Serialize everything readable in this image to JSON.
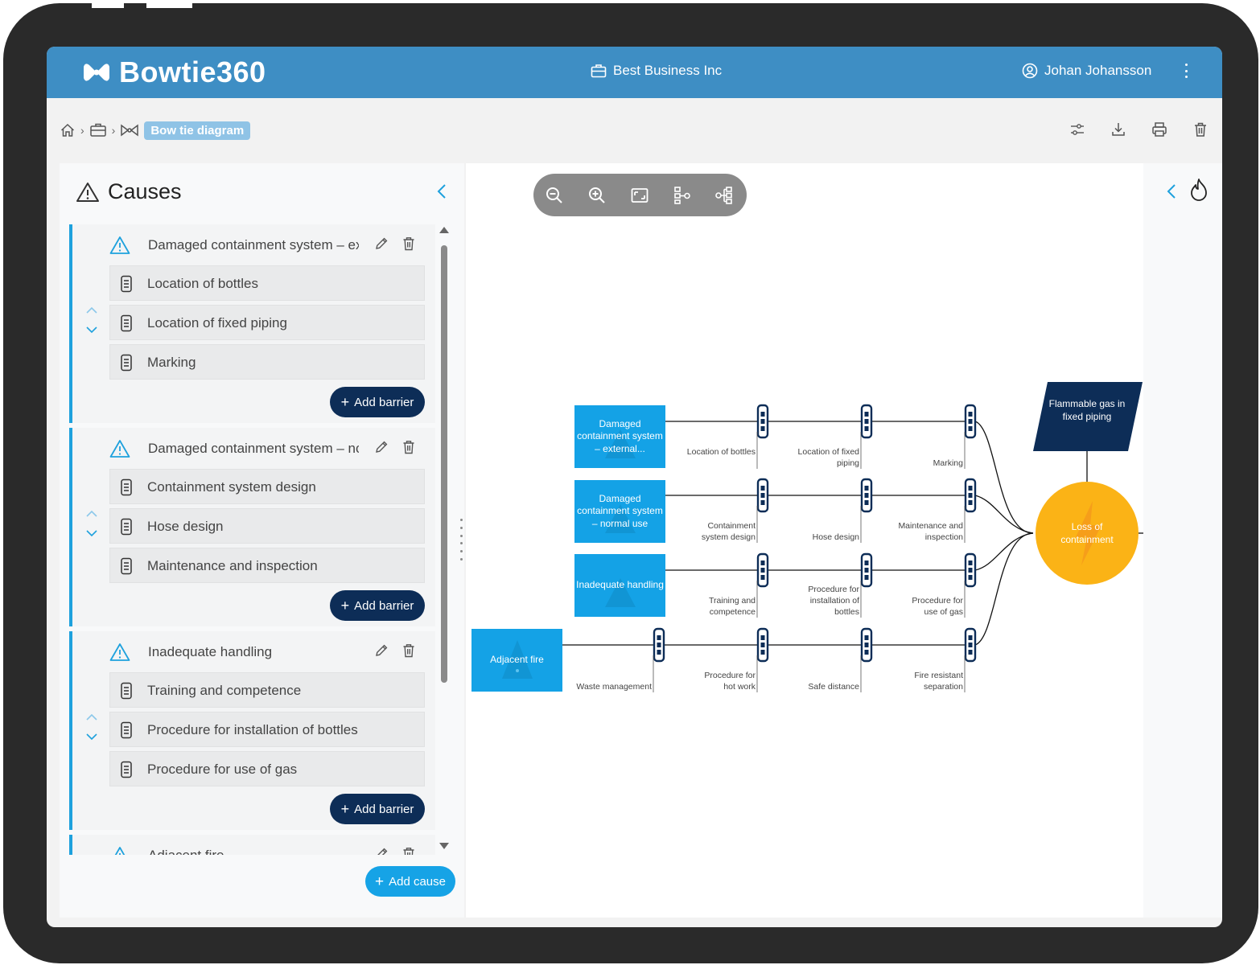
{
  "app": {
    "name": "Bowtie360",
    "company": "Best Business Inc",
    "user": "Johan Johansson"
  },
  "breadcrumb": {
    "current": "Bow tie diagram"
  },
  "causes_panel": {
    "title": "Causes",
    "add_barrier_label": "Add barrier",
    "add_cause_label": "Add cause",
    "causes": [
      {
        "name": "Damaged containment system – ex",
        "barriers": [
          "Location of bottles",
          " Location of fixed piping",
          "Marking"
        ]
      },
      {
        "name": "Damaged containment system – nc",
        "barriers": [
          "Containment system design",
          "Hose design",
          "Maintenance and  inspection"
        ]
      },
      {
        "name": "Inadequate handling",
        "barriers": [
          "Training and competence",
          "Procedure for installation of bottles",
          "Procedure for use of gas"
        ]
      },
      {
        "name": "Adjacent fire",
        "barriers": []
      }
    ]
  },
  "diagram": {
    "causes": [
      {
        "label": "Damaged containment system – external..."
      },
      {
        "label": "Damaged containment system – normal use"
      },
      {
        "label": "Inadequate handling"
      },
      {
        "label": "Adjacent fire"
      }
    ],
    "barrier_labels": {
      "row1": [
        "Location of bottles",
        "Location of fixed piping",
        "Marking"
      ],
      "row2": [
        "Containment system design",
        "Hose design",
        "Maintenance and inspection"
      ],
      "row3": [
        "Training and competence",
        "Procedure for installation of bottles",
        "Procedure for use of gas"
      ],
      "row4": [
        "Waste management",
        "Procedure for hot work",
        "Safe distance",
        "Fire resistant separation"
      ]
    },
    "hazard": "Flammable gas in fixed piping",
    "top_event": "Loss of containment"
  },
  "colors": {
    "header": "#3e8ec4",
    "cause_node": "#14a2e6",
    "hazard": "#0d2d57",
    "top_event": "#fbb316",
    "add_barrier": "#0d2d57",
    "add_cause": "#16a3e6"
  }
}
